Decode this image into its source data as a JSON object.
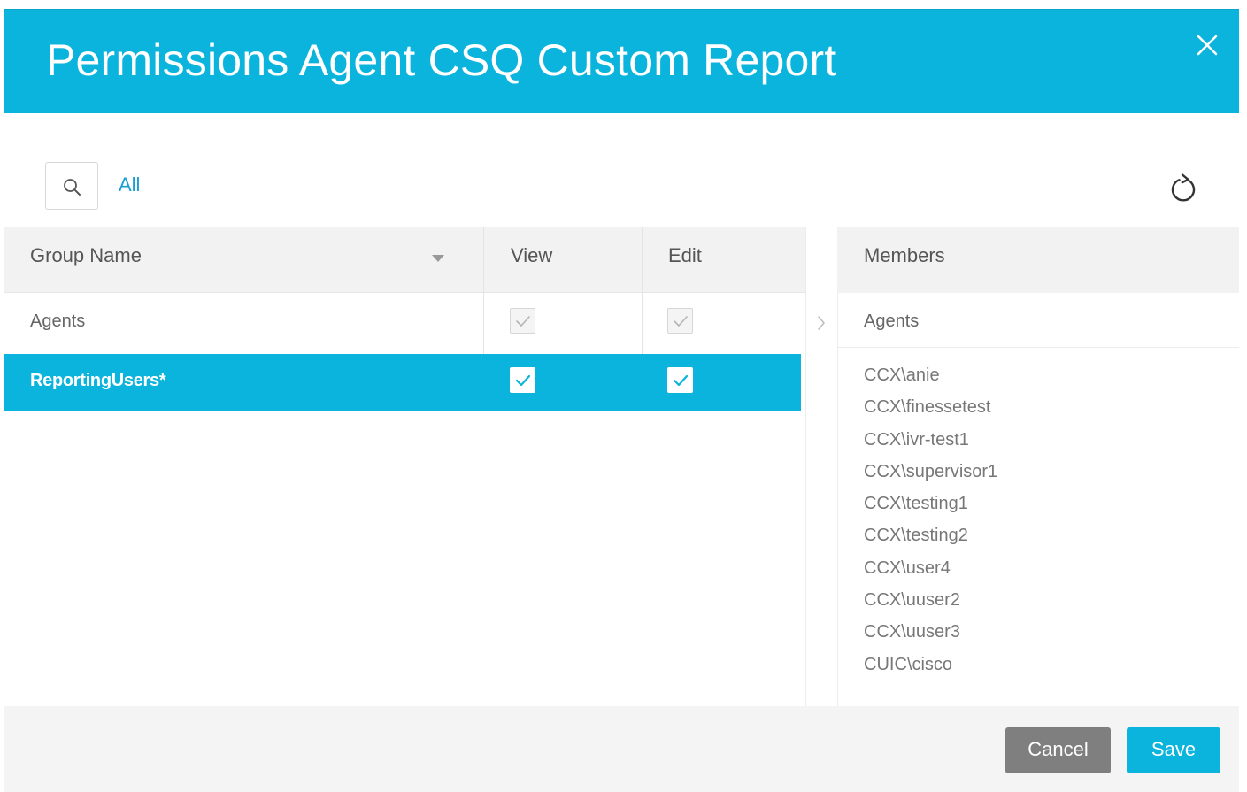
{
  "dialog": {
    "title": "Permissions Agent CSQ Custom Report"
  },
  "toolbar": {
    "filter_label": "All"
  },
  "groups_table": {
    "columns": {
      "group_name": "Group Name",
      "view": "View",
      "edit": "Edit"
    },
    "rows": [
      {
        "name": "Agents",
        "view": true,
        "edit": true,
        "disabled": true,
        "selected": false
      },
      {
        "name": "ReportingUsers*",
        "view": true,
        "edit": true,
        "disabled": false,
        "selected": true
      }
    ]
  },
  "members_panel": {
    "header": "Members",
    "group_name": "Agents",
    "members": [
      "CCX\\anie",
      "CCX\\finessetest",
      "CCX\\ivr-test1",
      "CCX\\supervisor1",
      "CCX\\testing1",
      "CCX\\testing2",
      "CCX\\user4",
      "CCX\\uuser2",
      "CCX\\uuser3",
      "CUIC\\cisco"
    ]
  },
  "footer": {
    "cancel_label": "Cancel",
    "save_label": "Save"
  },
  "colors": {
    "accent": "#0bb4dc",
    "link": "#1a9fd4",
    "cancel_button": "#7f7f7f",
    "header_bg": "#f2f2f2"
  },
  "icons": {
    "close": "close-icon",
    "search": "search-icon",
    "refresh": "refresh-icon",
    "sort": "caret-down-icon",
    "expand": "chevron-right-icon",
    "check": "checkmark-icon"
  }
}
